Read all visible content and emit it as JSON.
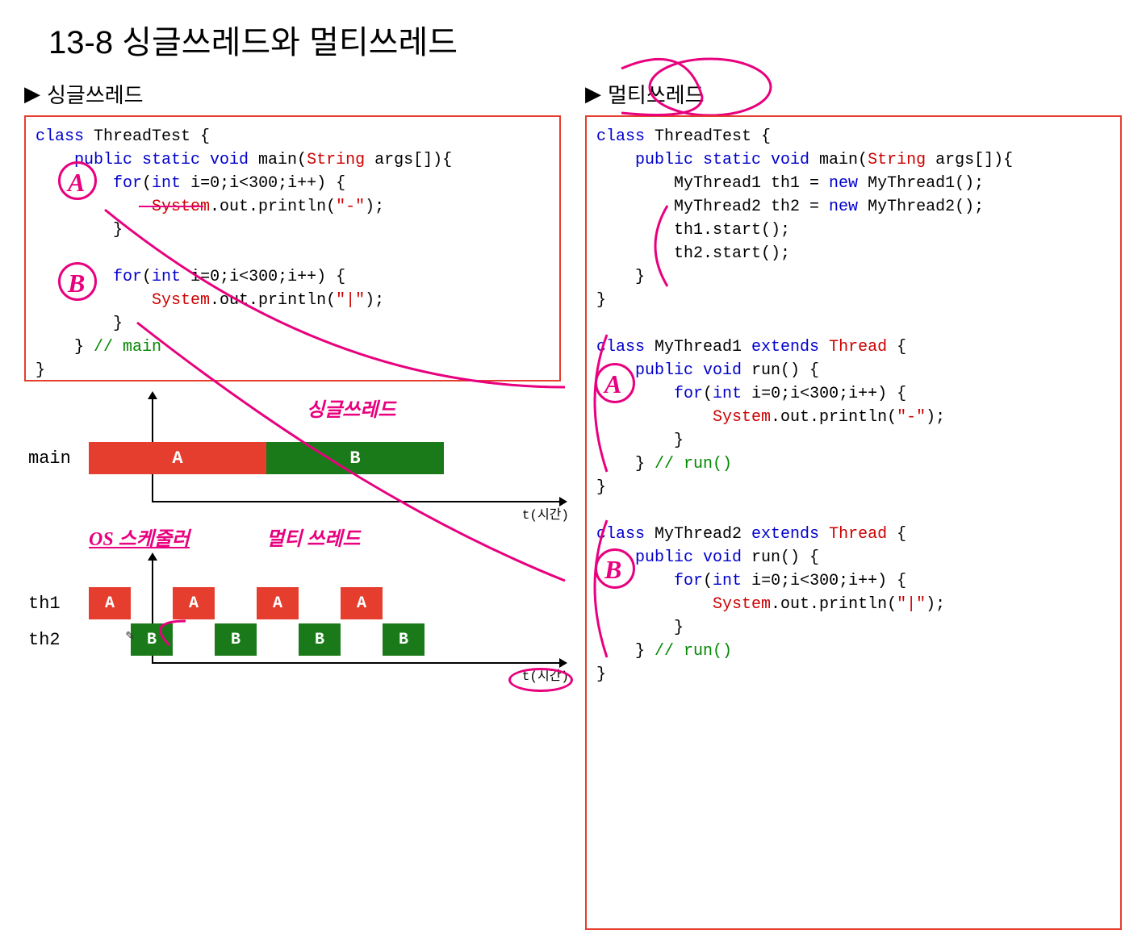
{
  "title": "13-8 싱글쓰레드와 멀티쓰레드",
  "left_heading": "싱글쓰레드",
  "right_heading": "멀티쓰레드",
  "triangle": "▶",
  "code_left": {
    "l1": "class",
    "l1b": " ThreadTest {",
    "l2": "    public static void",
    "l2b": " main(",
    "l2c": "String",
    "l2d": " args[]){",
    "l3": "        for",
    "l3b": "(",
    "l3c": "int",
    "l3d": " i=0;i<300;i++) {",
    "l4": "            System",
    "l4b": ".out.println(",
    "l4c": "\"-\"",
    "l4d": ");",
    "l5": "        }",
    "l6": "",
    "l7": "        for",
    "l7b": "(",
    "l7c": "int",
    "l7d": " i=0;i<300;i++) {",
    "l8": "            System",
    "l8b": ".out.println(",
    "l8c": "\"|\"",
    "l8d": ");",
    "l9": "        }",
    "l10": "    } ",
    "l10b": "// main",
    "l11": "}"
  },
  "code_right": {
    "a1": "class",
    "a1b": " ThreadTest {",
    "a2": "    public static void",
    "a2b": " main(",
    "a2c": "String",
    "a2d": " args[]){",
    "a3": "        MyThread1 th1 = ",
    "a3b": "new",
    "a3c": " MyThread1();",
    "a4": "        MyThread2 th2 = ",
    "a4b": "new",
    "a4c": " MyThread2();",
    "a5": "        th1.start();",
    "a6": "        th2.start();",
    "a7": "    }",
    "a8": "}",
    "b1": "class",
    "b1b": " MyThread1 ",
    "b1c": "extends",
    "b1d": " Thread",
    "b1e": " {",
    "b2": "    public void",
    "b2b": " run() {",
    "b3": "        for",
    "b3b": "(",
    "b3c": "int",
    "b3d": " i=0;i<300;i++) {",
    "b4": "            System",
    "b4b": ".out.println(",
    "b4c": "\"-\"",
    "b4d": ");",
    "b5": "        }",
    "b6": "    } ",
    "b6b": "// run()",
    "b7": "}",
    "c1": "class",
    "c1b": " MyThread2 ",
    "c1c": "extends",
    "c1d": " Thread",
    "c1e": " {",
    "c2": "    public void",
    "c2b": " run() {",
    "c3": "        for",
    "c3b": "(",
    "c3c": "int",
    "c3d": " i=0;i<300;i++) {",
    "c4": "            System",
    "c4b": ".out.println(",
    "c4c": "\"|\"",
    "c4d": ");",
    "c5": "        }",
    "c6": "    } ",
    "c6b": "// run()",
    "c7": "}"
  },
  "chart_data": [
    {
      "type": "bar",
      "title": "싱글쓰레드",
      "rows": [
        "main"
      ],
      "series": [
        {
          "name": "A",
          "thread": "main",
          "start": 0,
          "duration": 1,
          "color": "#e53e2e"
        },
        {
          "name": "B",
          "thread": "main",
          "start": 1,
          "duration": 1,
          "color": "#1a7a1a"
        }
      ],
      "xlabel": "t(시간)"
    },
    {
      "type": "bar",
      "title": "멀티쓰레드",
      "rows": [
        "th1",
        "th2"
      ],
      "series": [
        {
          "name": "A",
          "thread": "th1",
          "slots": [
            0,
            2,
            4,
            6
          ],
          "color": "#e53e2e"
        },
        {
          "name": "B",
          "thread": "th2",
          "slots": [
            1,
            3,
            5,
            7
          ],
          "color": "#1a7a1a"
        }
      ],
      "xlabel": "t(시간)"
    }
  ],
  "labels": {
    "main": "main",
    "th1": "th1",
    "th2": "th2",
    "A": "A",
    "B": "B",
    "xlabel": "t(시간)"
  },
  "annotations": {
    "markA": "A",
    "markB": "B",
    "hand_single": "싱글쓰레드",
    "hand_multi": "멀티 쓰레드",
    "hand_os": "OS 스케줄러",
    "pointer_icon": "✎"
  }
}
